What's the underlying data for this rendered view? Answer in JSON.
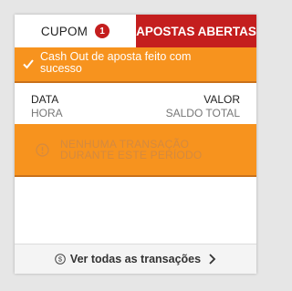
{
  "tabs": {
    "cupom_label": "CUPOM",
    "cupom_badge": "1",
    "apostas_label": "APOSTAS ABERTAS"
  },
  "notification": {
    "message": "Cash Out de aposta feito com sucesso",
    "icon": "check-icon"
  },
  "columns": {
    "data": "DATA",
    "hora": "HORA",
    "valor": "VALOR",
    "saldo_total": "SALDO TOTAL"
  },
  "empty_state": {
    "line1": "NENHUMA TRANSAÇÃO",
    "line2": "DURANTE ESTE PERÍODO",
    "icon": "info-icon"
  },
  "footer": {
    "link_label": "Ver todas as transações",
    "icon": "coin-icon"
  },
  "colors": {
    "accent_red": "#c41e1e",
    "accent_orange": "#f7931e"
  }
}
